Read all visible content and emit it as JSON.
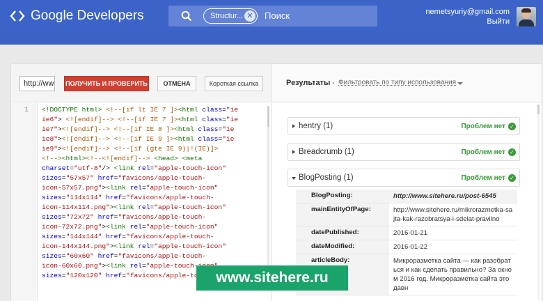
{
  "header": {
    "logo_text": "Google Developers",
    "search": {
      "chip": "Structur...",
      "chip_close": "✕",
      "text": "Поиск"
    },
    "user": {
      "email": "nemetsyuriy@gmail.com",
      "logout": "Выйти"
    }
  },
  "toolbar": {
    "url_value": "http://ww",
    "fetch_button": "ПОЛУЧИТЬ И ПРОВЕРИТЬ",
    "cancel_button": "ОТМЕНА",
    "short_link_button": "Короткая ссылка"
  },
  "results_header": {
    "title": "Результаты",
    "dash": "-",
    "filter": "Фильтровать по типу использования"
  },
  "code": {
    "line_number": "1"
  },
  "results": {
    "items": [
      {
        "name": "hentry (1)",
        "status": "Проблем нет"
      },
      {
        "name": "Breadcrumb (1)",
        "status": "Проблем нет"
      },
      {
        "name": "BlogPosting (1)",
        "status": "Проблем нет"
      }
    ],
    "properties": [
      {
        "key": "BlogPosting:",
        "value": "http://www.sitehere.ru/post-6545"
      },
      {
        "key": "mainEntityOfPage:",
        "value": "http://www.sitehere.ru/mikrorazmetka-sajta-kak-razobratsya-i-sdelat-pravilno"
      },
      {
        "key": "datePublished:",
        "value": "2016-01-21"
      },
      {
        "key": "dateModified:",
        "value": "2016-01-22"
      },
      {
        "key": "articleBody:",
        "value": "Микроразметка сайта — как разобраться и как сделать правильно? За окном 2016 год. Микроразметка сайта это давн"
      }
    ]
  },
  "watermark": "www.sitehere.ru",
  "colors": {
    "header": "#3c64c8",
    "action": "#d23f31",
    "ok": "#3a9a3a",
    "watermark": "#1aa36b"
  }
}
